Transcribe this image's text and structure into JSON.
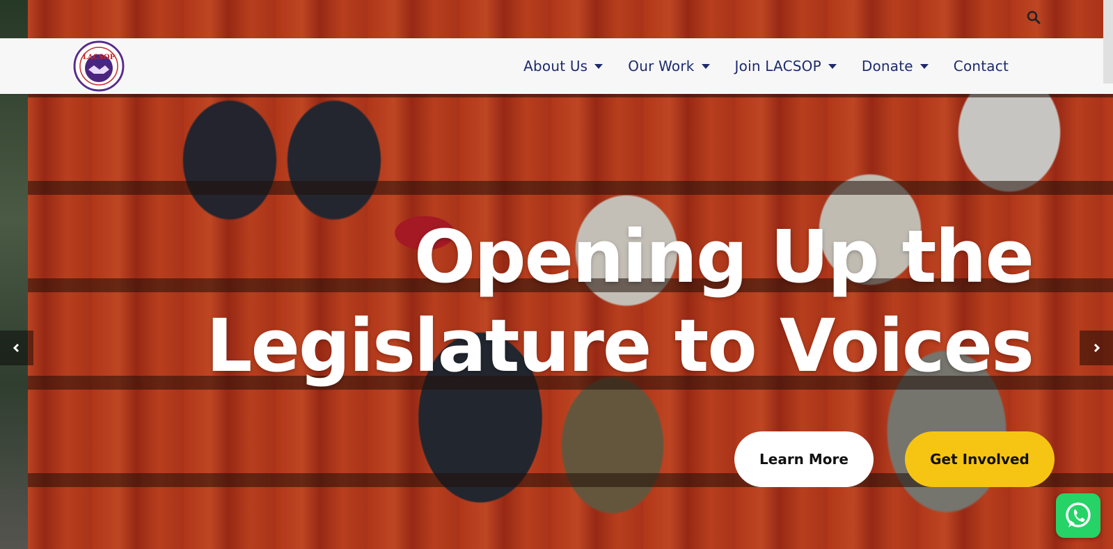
{
  "header": {
    "logo_text": "LACSOP",
    "search_icon": "search-icon"
  },
  "nav": {
    "items": [
      {
        "label": "About Us",
        "has_dropdown": true
      },
      {
        "label": "Our Work",
        "has_dropdown": true
      },
      {
        "label": "Join LACSOP",
        "has_dropdown": true
      },
      {
        "label": "Donate",
        "has_dropdown": true
      },
      {
        "label": "Contact",
        "has_dropdown": false
      }
    ]
  },
  "hero": {
    "headline_line1": "Opening Up the",
    "headline_line2": "Legislature to Voices",
    "learn_more_label": "Learn More",
    "get_involved_label": "Get Involved"
  },
  "colors": {
    "nav_text": "#1d2a6b",
    "accent_yellow": "#f6c513",
    "whatsapp_green": "#25d366"
  },
  "icons": {
    "prev": "chevron-left-icon",
    "next": "chevron-right-icon",
    "chat": "whatsapp-icon"
  }
}
